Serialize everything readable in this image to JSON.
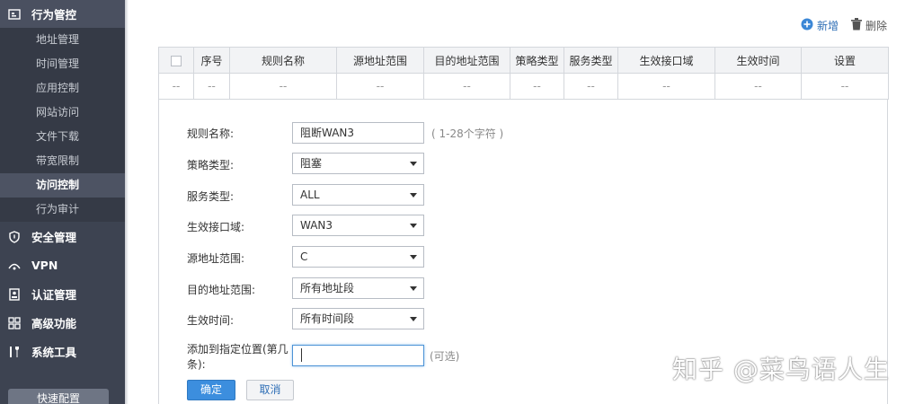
{
  "sidebar": {
    "sections": [
      {
        "label": "行为管控",
        "icon": "behavior-control-icon"
      },
      {
        "label": "安全管理",
        "icon": "shield-icon"
      },
      {
        "label": "VPN",
        "icon": "vpn-icon"
      },
      {
        "label": "认证管理",
        "icon": "auth-icon"
      },
      {
        "label": "高级功能",
        "icon": "grid-icon"
      },
      {
        "label": "系统工具",
        "icon": "tools-icon"
      }
    ],
    "items": [
      "地址管理",
      "时间管理",
      "应用控制",
      "网站访问",
      "文件下载",
      "带宽限制",
      "访问控制",
      "行为审计"
    ],
    "quick_config": "快速配置"
  },
  "toolbar": {
    "add_label": "新增",
    "delete_label": "删除"
  },
  "table": {
    "columns": [
      "序号",
      "规则名称",
      "源地址范围",
      "目的地址范围",
      "策略类型",
      "服务类型",
      "生效接口域",
      "生效时间",
      "设置"
    ],
    "empty_cell": "--"
  },
  "form": {
    "rule_name": {
      "label": "规则名称:",
      "value": "阻断WAN3",
      "hint": "( 1-28个字符 )"
    },
    "policy_type": {
      "label": "策略类型:",
      "value": "阻塞"
    },
    "service_type": {
      "label": "服务类型:",
      "value": "ALL"
    },
    "interface": {
      "label": "生效接口域:",
      "value": "WAN3"
    },
    "src_range": {
      "label": "源地址范围:",
      "value": "C"
    },
    "dst_range": {
      "label": "目的地址范围:",
      "value": "所有地址段"
    },
    "effective_time": {
      "label": "生效时间:",
      "value": "所有时间段"
    },
    "position": {
      "label_line1": "添加到指定位置(第几",
      "label_line2": "条):",
      "value": "",
      "hint": "(可选)"
    },
    "ok_label": "确定",
    "cancel_label": "取消"
  },
  "watermark": "知乎 @菜鸟语人生"
}
